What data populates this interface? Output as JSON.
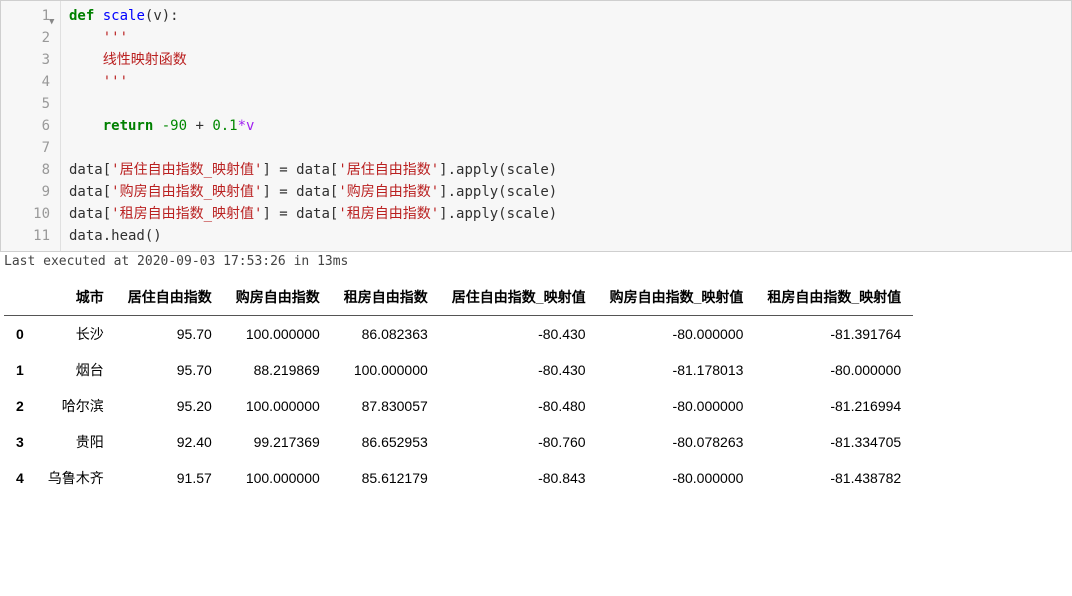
{
  "code": {
    "lines": [
      1,
      2,
      3,
      4,
      5,
      6,
      7,
      8,
      9,
      10,
      11
    ],
    "fold_at": 1,
    "kw_def": "def",
    "fn_name": "scale",
    "param_open": "(v):",
    "docq": "'''",
    "doctext": "线性映射函数",
    "kw_return": "return",
    "ret_expr_a": "-90",
    "ret_plus": " + ",
    "ret_expr_b": "0.1",
    "ret_tail": "*v",
    "assign1_lhs_a": "data[",
    "assign1_lhs_str": "'居住自由指数_映射值'",
    "assign1_rhs_pre": "] = data[",
    "assign1_rhs_str": "'居住自由指数'",
    "assign1_rhs_tail": "].apply(scale)",
    "assign2_lhs_str": "'购房自由指数_映射值'",
    "assign2_rhs_str": "'购房自由指数'",
    "assign3_lhs_str": "'租房自由指数_映射值'",
    "assign3_rhs_str": "'租房自由指数'",
    "last_line": "data.head()"
  },
  "exec": {
    "text": "Last executed at 2020-09-03 17:53:26 in 13ms"
  },
  "table": {
    "columns": [
      "城市",
      "居住自由指数",
      "购房自由指数",
      "租房自由指数",
      "居住自由指数_映射值",
      "购房自由指数_映射值",
      "租房自由指数_映射值"
    ],
    "index": [
      "0",
      "1",
      "2",
      "3",
      "4"
    ],
    "rows": [
      [
        "长沙",
        "95.70",
        "100.000000",
        "86.082363",
        "-80.430",
        "-80.000000",
        "-81.391764"
      ],
      [
        "烟台",
        "95.70",
        "88.219869",
        "100.000000",
        "-80.430",
        "-81.178013",
        "-80.000000"
      ],
      [
        "哈尔滨",
        "95.20",
        "100.000000",
        "87.830057",
        "-80.480",
        "-80.000000",
        "-81.216994"
      ],
      [
        "贵阳",
        "92.40",
        "99.217369",
        "86.652953",
        "-80.760",
        "-80.078263",
        "-81.334705"
      ],
      [
        "乌鲁木齐",
        "91.57",
        "100.000000",
        "85.612179",
        "-80.843",
        "-80.000000",
        "-81.438782"
      ]
    ]
  }
}
